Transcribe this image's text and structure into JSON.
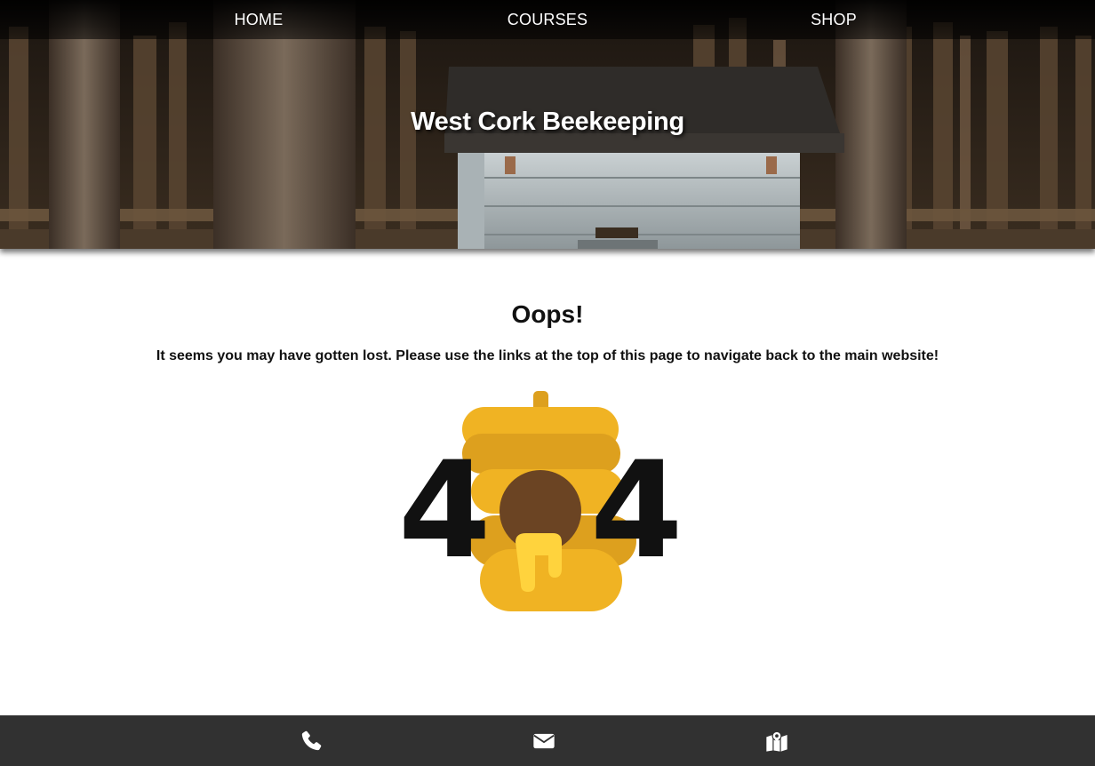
{
  "nav": {
    "links": [
      {
        "label": "HOME"
      },
      {
        "label": "COURSES"
      },
      {
        "label": "SHOP"
      }
    ]
  },
  "hero": {
    "title": "West Cork Beekeeping"
  },
  "main": {
    "heading": "Oops!",
    "message": "It seems you may have gotten lost. Please use the links at the top of this page to navigate back to the main website!",
    "error_code": {
      "digit_left": "4",
      "digit_right": "4"
    }
  },
  "footer": {
    "icons": [
      "phone-icon",
      "envelope-icon",
      "map-icon"
    ]
  },
  "colors": {
    "hive_light": "#F0B323",
    "hive_dark": "#DDA01E",
    "hive_entrance": "#6B4423",
    "honey_drip": "#FFD33D",
    "footer_bg": "#313131"
  }
}
